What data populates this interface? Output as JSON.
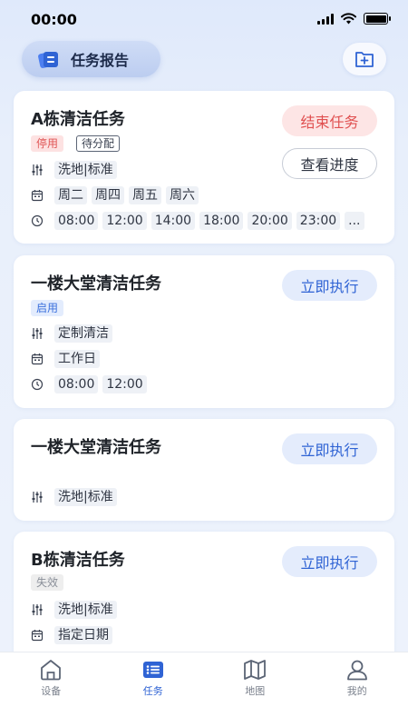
{
  "status_bar": {
    "time": "00:00"
  },
  "header": {
    "report_label": "任务报告"
  },
  "tasks": [
    {
      "title": "A栋清洁任务",
      "badges": [
        "停用",
        "待分配"
      ],
      "mode": "洗地|标准",
      "days": [
        "周二",
        "周四",
        "周五",
        "周六"
      ],
      "times": [
        "08:00",
        "12:00",
        "14:00",
        "18:00",
        "20:00",
        "23:00",
        "..."
      ],
      "buttons": [
        "结束任务",
        "查看进度"
      ]
    },
    {
      "title": "一楼大堂清洁任务",
      "badges": [
        "启用"
      ],
      "mode": "定制清洁",
      "days": [
        "工作日"
      ],
      "times": [
        "08:00",
        "12:00"
      ],
      "buttons": [
        "立即执行"
      ]
    },
    {
      "title": "一楼大堂清洁任务",
      "mode": "洗地|标准",
      "buttons": [
        "立即执行"
      ]
    },
    {
      "title": "B栋清洁任务",
      "badges": [
        "失效"
      ],
      "mode": "洗地|标准",
      "days": [
        "指定日期"
      ],
      "buttons": [
        "立即执行"
      ]
    }
  ],
  "tab_bar": {
    "tabs": [
      {
        "label": "设备",
        "icon": "home-icon"
      },
      {
        "label": "任务",
        "icon": "task-list-icon",
        "active": true
      },
      {
        "label": "地图",
        "icon": "map-icon"
      },
      {
        "label": "我的",
        "icon": "user-icon"
      }
    ]
  },
  "colors": {
    "accent": "#2f63d4",
    "danger": "#e05050",
    "background": "#eef3fc"
  }
}
